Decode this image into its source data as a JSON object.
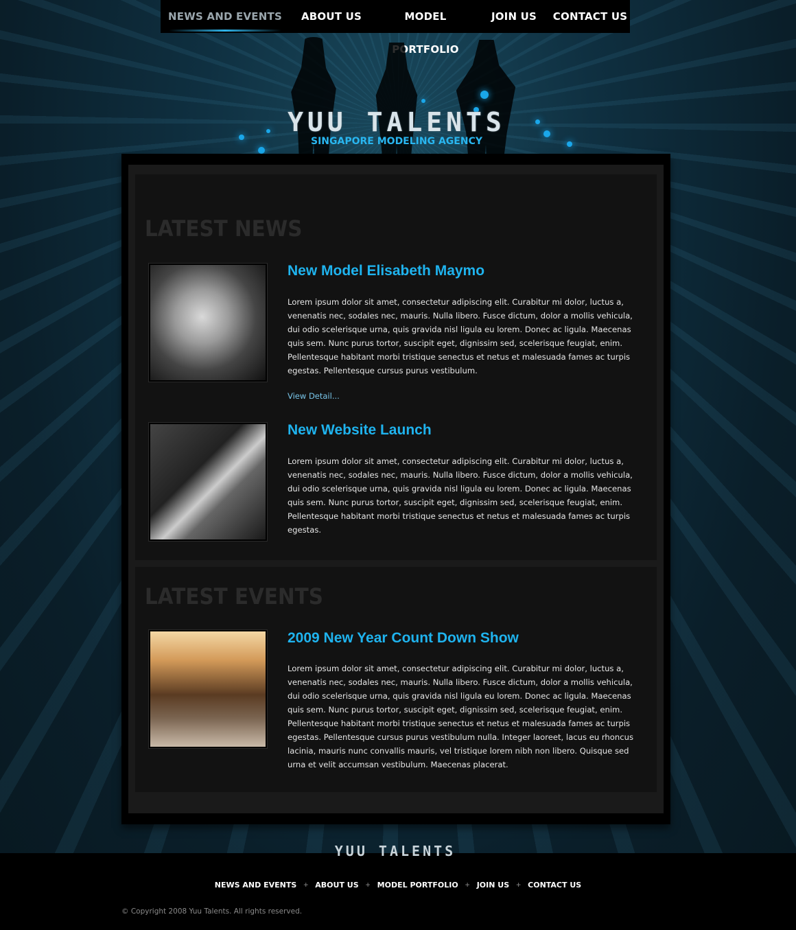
{
  "nav": {
    "items": [
      {
        "label": "NEWS AND EVENTS",
        "active": true
      },
      {
        "label": "ABOUT US"
      },
      {
        "label": "MODEL PORTFOLIO"
      },
      {
        "label": "JOIN US"
      },
      {
        "label": "CONTACT US"
      }
    ]
  },
  "brand": {
    "logo": "YUU TALENTS",
    "tagline": "SINGAPORE MODELING AGENCY",
    "accent_color": "#1fb3ee"
  },
  "news": {
    "title": "LATEST NEWS",
    "posts": [
      {
        "title": "New Model Elisabeth Maymo",
        "body": "Lorem ipsum dolor sit amet, consectetur adipiscing elit. Curabitur mi dolor, luctus a, venenatis nec, sodales nec, mauris. Nulla libero. Fusce dictum, dolor a mollis vehicula, dui odio scelerisque urna, quis gravida nisl ligula eu lorem. Donec ac ligula. Maecenas quis sem. Nunc purus tortor, suscipit eget, dignissim sed, scelerisque feugiat, enim. Pellentesque habitant morbi tristique senectus et netus et malesuada fames ac turpis egestas. Pellentesque cursus purus vestibulum.",
        "link": "View Detail..."
      },
      {
        "title": "New Website Launch",
        "body": "Lorem ipsum dolor sit amet, consectetur adipiscing elit. Curabitur mi dolor, luctus a, venenatis nec, sodales nec, mauris. Nulla libero. Fusce dictum, dolor a mollis vehicula, dui odio scelerisque urna, quis gravida nisl ligula eu lorem. Donec ac ligula. Maecenas quis sem. Nunc purus tortor, suscipit eget, dignissim sed, scelerisque feugiat, enim. Pellentesque habitant morbi tristique senectus et netus et malesuada fames ac turpis egestas."
      }
    ]
  },
  "events": {
    "title": "LATEST EVENTS",
    "posts": [
      {
        "title": "2009 New Year Count Down Show",
        "body": "Lorem ipsum dolor sit amet, consectetur adipiscing elit. Curabitur mi dolor, luctus a, venenatis nec, sodales nec, mauris. Nulla libero. Fusce dictum, dolor a mollis vehicula, dui odio scelerisque urna, quis gravida nisl ligula eu lorem. Donec ac ligula. Maecenas quis sem. Nunc purus tortor, suscipit eget, dignissim sed, scelerisque feugiat, enim. Pellentesque habitant morbi tristique senectus et netus et malesuada fames ac turpis egestas. Pellentesque cursus purus vestibulum nulla. Integer laoreet, lacus eu rhoncus lacinia, mauris nunc convallis mauris, vel tristique lorem nibh non libero. Quisque sed urna et velit accumsan vestibulum. Maecenas placerat."
      }
    ]
  },
  "footer": {
    "logo": "YUU TALENTS",
    "nav": [
      "NEWS AND EVENTS",
      "ABOUT US",
      "MODEL PORTFOLIO",
      "JOIN US",
      "CONTACT US"
    ],
    "separator": "+",
    "copyright": "© Copyright 2008 Yuu Talents. All rights reserved."
  }
}
